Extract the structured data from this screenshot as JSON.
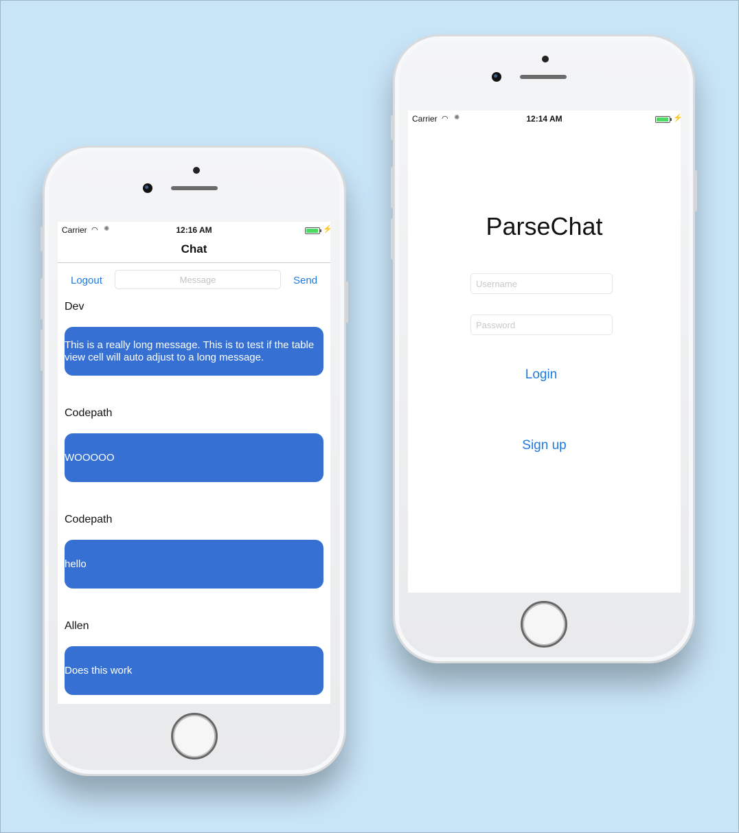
{
  "chat_screen": {
    "status": {
      "carrier": "Carrier",
      "time": "12:16 AM"
    },
    "nav_title": "Chat",
    "logout_label": "Logout",
    "send_label": "Send",
    "message_placeholder": "Message",
    "messages": [
      {
        "user": "Dev",
        "text": "This is a really long message. This is to test if the table view cell will auto adjust to a long message."
      },
      {
        "user": "Codepath",
        "text": "WOOOOO"
      },
      {
        "user": "Codepath",
        "text": "hello"
      },
      {
        "user": "Allen",
        "text": "Does this work"
      }
    ]
  },
  "login_screen": {
    "status": {
      "carrier": "Carrier",
      "time": "12:14 AM"
    },
    "app_title": "ParseChat",
    "username_placeholder": "Username",
    "password_placeholder": "Password",
    "login_label": "Login",
    "signup_label": "Sign up"
  },
  "colors": {
    "background": "#c8e4f7",
    "bubble": "#3670d3",
    "link": "#1f7ae0",
    "battery": "#4cd964"
  }
}
